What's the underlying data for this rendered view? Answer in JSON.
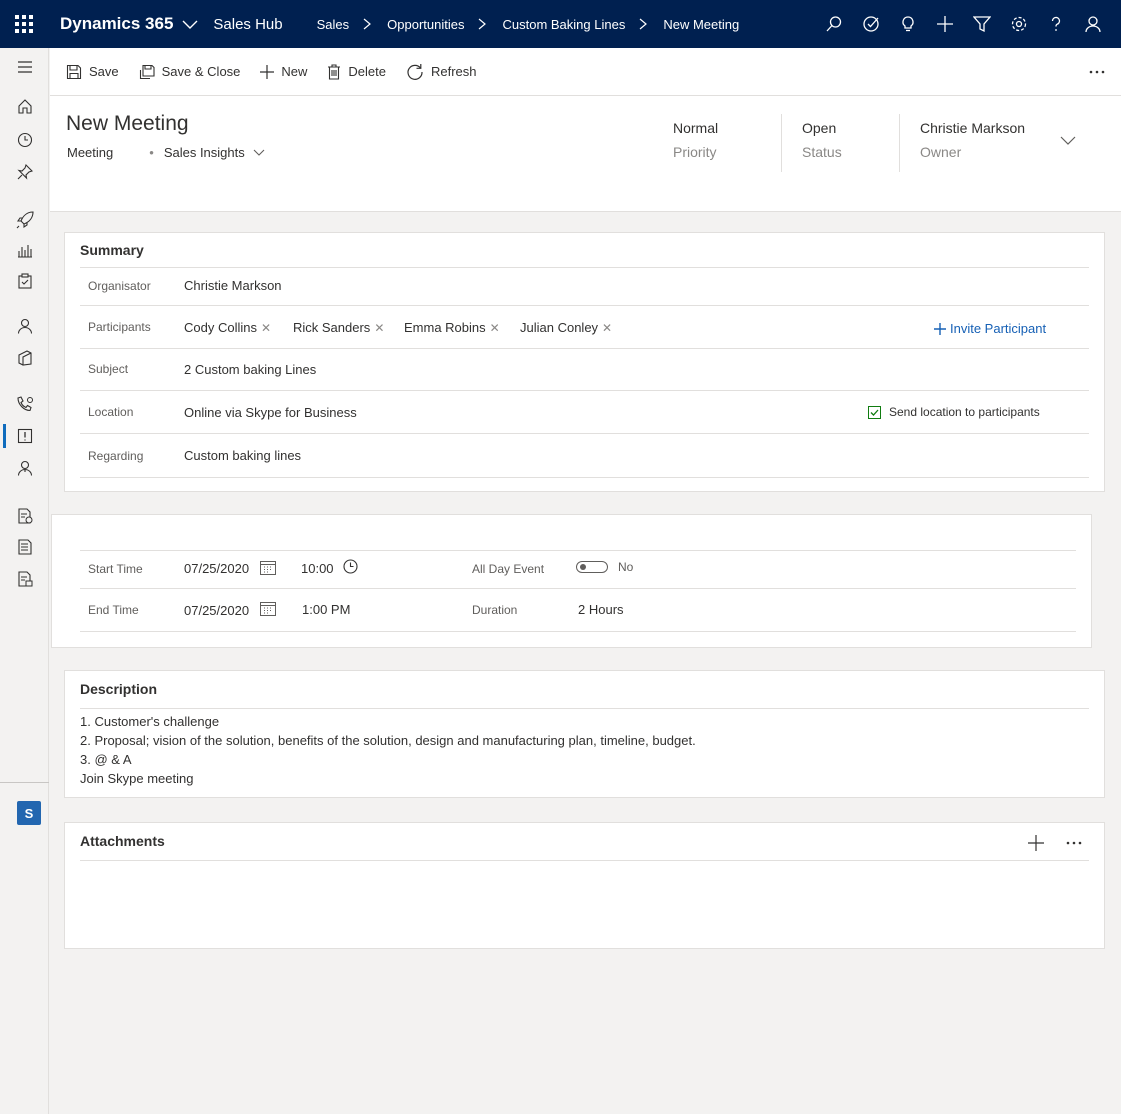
{
  "topbar": {
    "app_name": "Dynamics 365",
    "hub_name": "Sales Hub",
    "breadcrumb": [
      "Sales",
      "Opportunities",
      "Custom Baking Lines",
      "New Meeting"
    ]
  },
  "commands": {
    "save": "Save",
    "save_close": "Save & Close",
    "new": "New",
    "delete": "Delete",
    "refresh": "Refresh"
  },
  "header": {
    "title": "New Meeting",
    "entity": "Meeting",
    "form_selector": "Sales Insights",
    "priority_value": "Normal",
    "priority_label": "Priority",
    "status_value": "Open",
    "status_label": "Status",
    "owner_value": "Christie Markson",
    "owner_label": "Owner"
  },
  "summary": {
    "title": "Summary",
    "organiser_label": "Organisator",
    "organiser_value": "Christie Markson",
    "participants_label": "Participants",
    "participants": [
      "Cody Collins",
      "Rick Sanders",
      "Emma Robins",
      "Julian Conley"
    ],
    "invite_label": "Invite Participant",
    "subject_label": "Subject",
    "subject_value": "2 Custom baking Lines",
    "location_label": "Location",
    "location_value": "Online via Skype for Business",
    "send_location_label": "Send location to participants",
    "regarding_label": "Regarding",
    "regarding_value": "Custom baking lines"
  },
  "schedule": {
    "start_label": "Start Time",
    "start_date": "07/25/2020",
    "start_time": "10:00",
    "end_label": "End Time",
    "end_date": "07/25/2020",
    "end_time": "1:00 PM",
    "all_day_label": "All Day Event",
    "all_day_value": "No",
    "duration_label": "Duration",
    "duration_value": "2 Hours"
  },
  "description": {
    "title": "Description",
    "lines": [
      "1. Customer's challenge",
      "2. Proposal; vision of the solution, benefits of the solution, design and manufacturing plan, timeline, budget.",
      "3. @ & A",
      "Join Skype meeting"
    ]
  },
  "attachments": {
    "title": "Attachments"
  },
  "left_nav": {
    "area_badge": "S"
  }
}
